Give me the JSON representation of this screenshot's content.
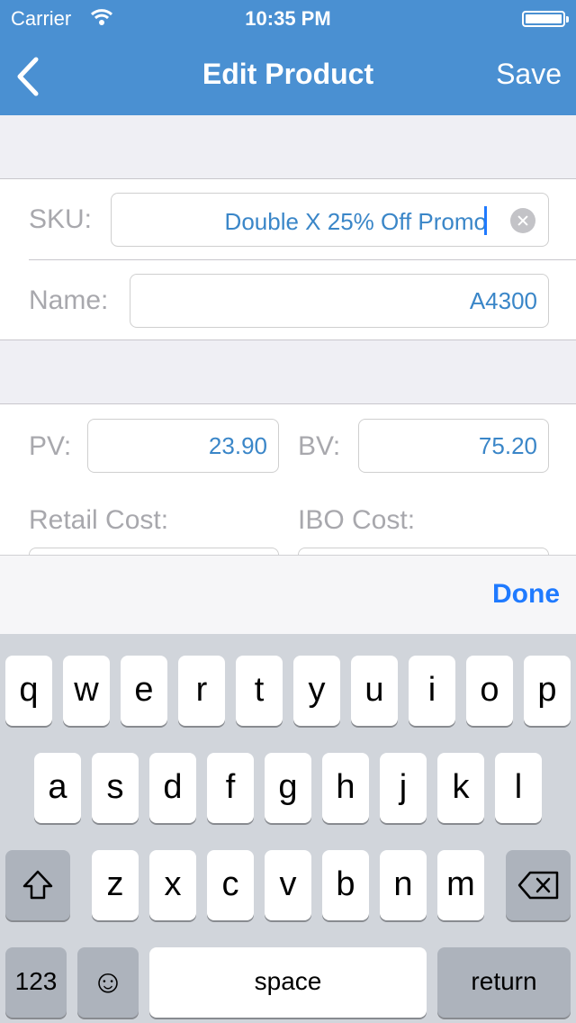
{
  "status": {
    "carrier": "Carrier",
    "time": "10:35 PM"
  },
  "nav": {
    "title": "Edit Product",
    "save_label": "Save"
  },
  "form": {
    "sku_label": "SKU:",
    "sku_value": "Double X 25% Off Promo",
    "name_label": "Name:",
    "name_value": "A4300",
    "pv_label": "PV:",
    "pv_value": "23.90",
    "bv_label": "BV:",
    "bv_value": "75.20",
    "retail_label": "Retail Cost:",
    "ibo_label": "IBO Cost:"
  },
  "accessory": {
    "done_label": "Done"
  },
  "keyboard": {
    "row1": [
      "q",
      "w",
      "e",
      "r",
      "t",
      "y",
      "u",
      "i",
      "o",
      "p"
    ],
    "row2": [
      "a",
      "s",
      "d",
      "f",
      "g",
      "h",
      "j",
      "k",
      "l"
    ],
    "row3": [
      "z",
      "x",
      "c",
      "v",
      "b",
      "n",
      "m"
    ],
    "num_label": "123",
    "space_label": "space",
    "return_label": "return",
    "emoji": "☺"
  }
}
